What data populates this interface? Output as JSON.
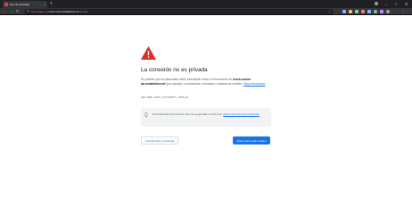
{
  "browser": {
    "tab": {
      "title": "Error de privacidad",
      "close": "×"
    },
    "new_tab": "+",
    "window_controls": {
      "minimize": "–",
      "maximize": "□",
      "close": "✕"
    },
    "nav": {
      "back": "←",
      "forward": "→",
      "reload": "↻"
    },
    "address": {
      "security_label": "No es seguro",
      "url_host": "reset-course-rpisalabhtml.net",
      "url_path": "/api-stast"
    },
    "bookmark_star": "☆",
    "extension_colors": [
      "#8ab4f8",
      "#fdd663",
      "#81c995",
      "#f28b82",
      "#8ab4f8",
      "#81c995",
      "#c58af9",
      "#9aa0a6"
    ],
    "menu": "⋮"
  },
  "interstitial": {
    "icon": "warning-triangle-icon",
    "icon_color": "#d93025",
    "title": "La conexión no es privada",
    "message_before": "Es posible que los atacantes estén intentando robar tu información de ",
    "message_host": "reset-course-rpi.asdabhtml.net",
    "message_after": " (por ejemplo, contraseñas, mensajes o tarjetas de crédito). ",
    "learn_more": "Más información",
    "error_code": "NET::ERR_CERT_AUTHORITY_INVALID",
    "safe_browsing": {
      "icon": "lightbulb-icon",
      "text": "Para disfrutar del máximo nivel de seguridad en Chrome, ",
      "link": "activa la protección mejorada."
    },
    "advanced_button": "Configuración avanzada",
    "back_button": "Volver para estar a salvo"
  }
}
